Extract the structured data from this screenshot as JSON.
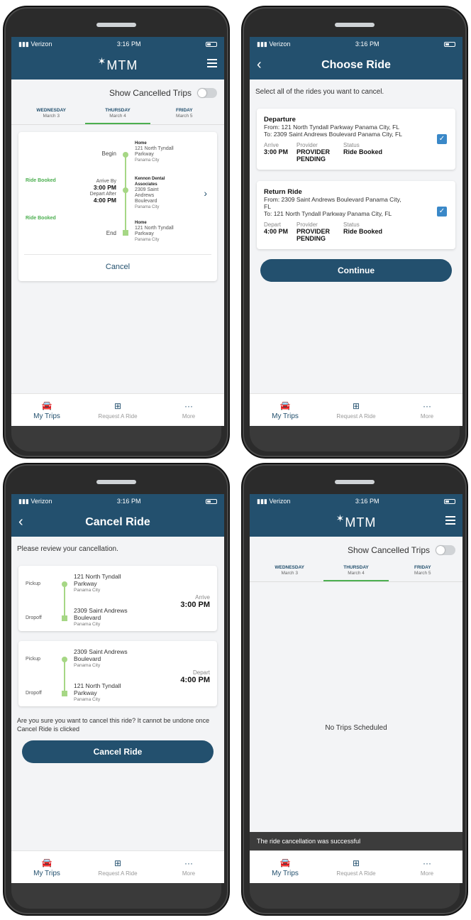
{
  "status": {
    "carrier": "Verizon",
    "time": "3:16 PM"
  },
  "app": {
    "logo": "MTM"
  },
  "toggle_label": "Show Cancelled Trips",
  "days": [
    {
      "name": "WEDNESDAY",
      "date": "March 3"
    },
    {
      "name": "THURSDAY",
      "date": "March 4"
    },
    {
      "name": "FRIDAY",
      "date": "March 5"
    }
  ],
  "tabs": {
    "trips": "My Trips",
    "request": "Request A Ride",
    "more": "More"
  },
  "phone1": {
    "status_top": "Ride Booked",
    "status_bottom": "Ride Booked",
    "begin": "Begin",
    "arrive_by": "Arrive By",
    "arrive_time": "3:00 PM",
    "depart_after": "Depart After",
    "depart_time": "4:00 PM",
    "end": "End",
    "stops": [
      {
        "title": "Home",
        "line1": "121 North Tyndall",
        "line2": "Parkway",
        "city": "Panama City"
      },
      {
        "title": "Kennon Dental Associates",
        "line1": "2309 Saint",
        "line2": "Andrews",
        "line3": "Boulevard",
        "city": "Panama City"
      },
      {
        "title": "Home",
        "line1": "121 North Tyndall",
        "line2": "Parkway",
        "city": "Panama City"
      }
    ],
    "cancel": "Cancel"
  },
  "phone2": {
    "title": "Choose Ride",
    "intro": "Select all of the rides you want to cancel.",
    "rides": [
      {
        "title": "Departure",
        "from": "From: 121 North Tyndall Parkway  Panama City, FL",
        "to": "To: 2309 Saint Andrews Boulevard  Panama City, FL",
        "time_label": "Arrive",
        "time": "3:00 PM",
        "provider_label": "Provider",
        "provider": "PROVIDER PENDING",
        "status_label": "Status",
        "status": "Ride Booked"
      },
      {
        "title": "Return Ride",
        "from": "From: 2309 Saint Andrews Boulevard Panama City, FL",
        "to": "To: 121 North Tyndall Parkway  Panama City, FL",
        "time_label": "Depart",
        "time": "4:00 PM",
        "provider_label": "Provider",
        "provider": "PROVIDER PENDING",
        "status_label": "Status",
        "status": "Ride Booked"
      }
    ],
    "continue": "Continue"
  },
  "phone3": {
    "title": "Cancel Ride",
    "intro": "Please review your cancellation.",
    "pickup": "Pickup",
    "dropoff": "Dropoff",
    "legs": [
      {
        "pickup_l1": "121 North Tyndall",
        "pickup_l2": "Parkway",
        "pickup_city": "Panama City",
        "drop_l1": "2309 Saint Andrews",
        "drop_l2": "Boulevard",
        "drop_city": "Panama City",
        "time_label": "Arrive",
        "time": "3:00 PM"
      },
      {
        "pickup_l1": "2309 Saint Andrews",
        "pickup_l2": "Boulevard",
        "pickup_city": "Panama City",
        "drop_l1": "121 North Tyndall",
        "drop_l2": "Parkway",
        "drop_city": "Panama City",
        "time_label": "Depart",
        "time": "4:00 PM"
      }
    ],
    "warning": "Are you sure you want to cancel this ride? It cannot be undone once Cancel Ride is clicked",
    "button": "Cancel Ride"
  },
  "phone4": {
    "empty": "No Trips Scheduled",
    "toast": "The ride cancellation was successful"
  },
  "colors": {
    "brand": "#23506e",
    "accent_green": "#4caf50",
    "route": "#a6d785",
    "checkbox": "#3a88c8"
  },
  "icons": [
    "signal-icon",
    "wifi-icon",
    "battery-icon",
    "back-icon",
    "menu-icon",
    "car-icon",
    "plus-box-icon",
    "more-dots-icon",
    "chevron-right-icon",
    "checkbox-checked-icon",
    "logo-icon"
  ]
}
